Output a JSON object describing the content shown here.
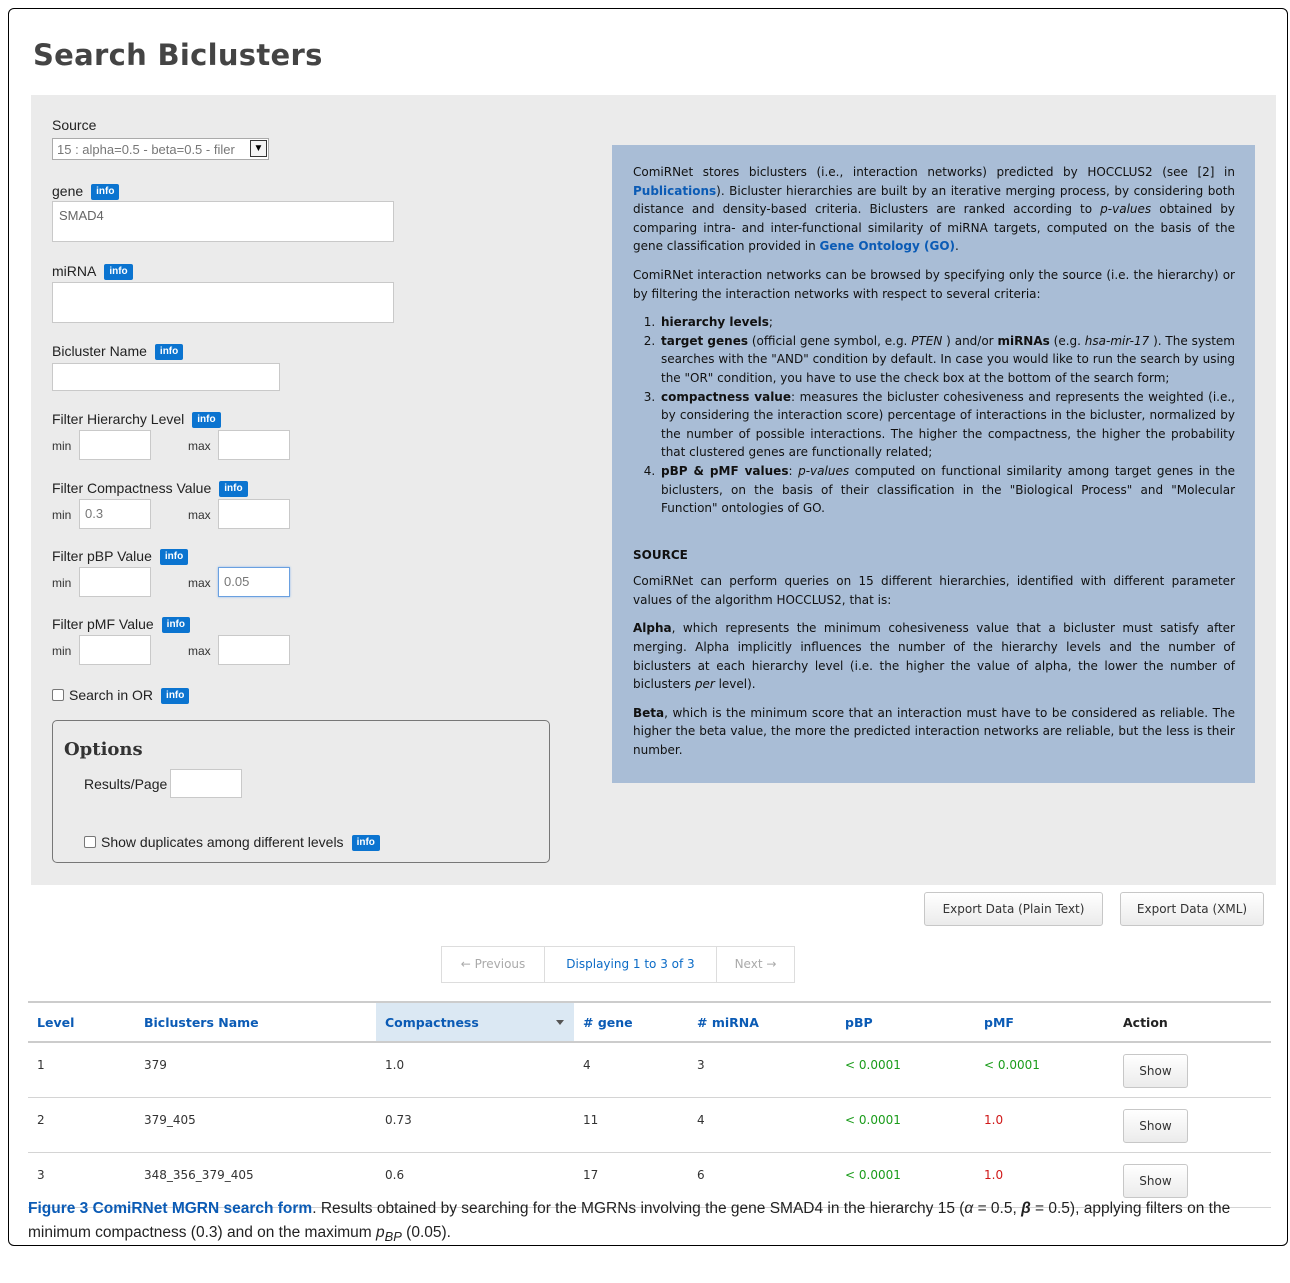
{
  "page_title": "Search Biclusters",
  "form": {
    "source_label": "Source",
    "source_value": "15 : alpha=0.5 - beta=0.5 - filer",
    "gene_label": "gene",
    "gene_value": "SMAD4",
    "mirna_label": "miRNA",
    "mirna_value": "",
    "bicluster_name_label": "Bicluster Name",
    "bicluster_name_value": "",
    "info_label": "info",
    "min_label": "min",
    "max_label": "max",
    "hierarchy_label": "Filter Hierarchy Level",
    "hierarchy_min": "",
    "hierarchy_max": "",
    "compactness_label": "Filter Compactness Value",
    "compactness_min": "0.3",
    "compactness_max": "",
    "pbp_label": "Filter pBP Value",
    "pbp_min": "",
    "pbp_max": "0.05",
    "pmf_label": "Filter pMF Value",
    "pmf_min": "",
    "pmf_max": "",
    "search_or_label": "Search in OR",
    "search_or_checked": false
  },
  "options": {
    "title": "Options",
    "results_per_page_label": "Results/Page",
    "results_per_page_value": "",
    "show_duplicates_label": "Show duplicates among different levels",
    "show_duplicates_checked": false
  },
  "description": {
    "p1_a": "ComiRNet stores biclusters (i.e., interaction networks) predicted by HOCCLUS2 (see [2] in ",
    "p1_link1": "Publications",
    "p1_b": "). Bicluster hierarchies are built by an iterative merging process, by considering both distance and density-based criteria. Biclusters are ranked according to ",
    "p1_em": "p-values",
    "p1_c": " obtained by comparing intra- and inter-functional similarity of miRNA targets, computed on the basis of the gene classification provided in ",
    "p1_link2": "Gene Ontology (GO)",
    "p1_d": ".",
    "p2": "ComiRNet interaction networks can be browsed by specifying only the source (i.e. the hierarchy) or by filtering the interaction networks with respect to several criteria:",
    "li1_b": "hierarchy levels",
    "li1_rest": ";",
    "li2_b": "target genes",
    "li2_a": " (official gene symbol, e.g. ",
    "li2_em1": "PTEN",
    "li2_b2": " ) and/or ",
    "li2_bold2": "miRNAs",
    "li2_c": " (e.g. ",
    "li2_em2": "hsa-mir-17",
    "li2_d": " ). The system searches with the \"AND\" condition by default. In case you would like to run the search by using the \"OR\" condition, you have to use the check box at the bottom of the search form;",
    "li3_b": "compactness value",
    "li3_rest": ": measures the bicluster cohesiveness and represents the weighted (i.e., by considering the interaction score) percentage of interactions in the bicluster, normalized by the number of possible interactions. The higher the compactness, the higher the probability that clustered genes are functionally related;",
    "li4_b": "pBP & pMF values",
    "li4_a": ": ",
    "li4_em": "p-values",
    "li4_rest": " computed on functional similarity among target genes in the biclusters, on the basis of their classification in the \"Biological Process\" and \"Molecular Function\" ontologies of GO.",
    "source_heading": "SOURCE",
    "p3": "ComiRNet can perform queries on 15 different hierarchies, identified with different parameter values of the algorithm HOCCLUS2, that is:",
    "p4_b": "Alpha",
    "p4_a": ", which represents the minimum cohesiveness value that a bicluster must satisfy after merging. Alpha implicitly influences the number of the hierarchy levels and the number of biclusters at each hierarchy level (i.e. the higher the value of alpha, the lower the number of biclusters ",
    "p4_em": "per",
    "p4_c": " level).",
    "p5_b": "Beta",
    "p5_a": ", which is the minimum score that an interaction must have to be considered as reliable. The higher the beta value, the more the predicted interaction networks are reliable, but the less is their number."
  },
  "export": {
    "plain_label": "Export Data (Plain Text)",
    "xml_label": "Export Data (XML)"
  },
  "pagination": {
    "previous": "← Previous",
    "status": "Displaying 1 to 3 of 3",
    "next": "Next →"
  },
  "table": {
    "headers": [
      "Level",
      "Biclusters Name",
      "Compactness",
      "# gene",
      "# miRNA",
      "pBP",
      "pMF",
      "Action"
    ],
    "rows": [
      {
        "level": "1",
        "name": "379",
        "compactness": "1.0",
        "genes": "4",
        "mirna": "3",
        "pbp": "< 0.0001",
        "pmf": "< 0.0001",
        "action": "Show"
      },
      {
        "level": "2",
        "name": "379_405",
        "compactness": "0.73",
        "genes": "11",
        "mirna": "4",
        "pbp": "< 0.0001",
        "pmf": "1.0",
        "action": "Show"
      },
      {
        "level": "3",
        "name": "348_356_379_405",
        "compactness": "0.6",
        "genes": "17",
        "mirna": "6",
        "pbp": "< 0.0001",
        "pmf": "1.0",
        "action": "Show"
      }
    ]
  },
  "caption": {
    "title": "Figure 3 ComiRNet MGRN search form",
    "text_a": ". Results obtained by searching for the MGRNs involving the gene SMAD4 in the hierarchy 15 (",
    "alpha_sym": "α",
    "text_b": " = 0.5, ",
    "beta_sym": "β",
    "text_c": " = 0.5), applying filters on the minimum compactness (0.3) and on the maximum ",
    "p_sym": "p",
    "p_sub": "BP",
    "text_d": " (0.05)."
  },
  "colors": {
    "link_blue": "#0b5bb5",
    "info_badge": "#0b74d0",
    "panel_bg": "#ebebeb",
    "desc_bg": "#a9bdd6",
    "green": "#1a9c1a",
    "red": "#d01818"
  }
}
